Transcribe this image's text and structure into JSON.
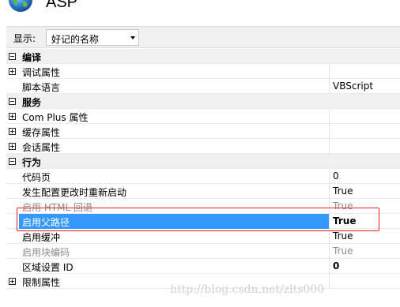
{
  "header": {
    "title": "ASP",
    "icon": "globe-icon"
  },
  "toolbar": {
    "display_label": "显示:",
    "sort_value": "好记的名称"
  },
  "grid": {
    "rows": [
      {
        "type": "category",
        "label": "编译",
        "expander": "minus"
      },
      {
        "type": "group",
        "label": "调试属性",
        "value": "",
        "expander": "plus"
      },
      {
        "type": "prop",
        "label": "脚本语言",
        "value": "VBScript"
      },
      {
        "type": "category",
        "label": "服务",
        "expander": "minus"
      },
      {
        "type": "group",
        "label": "Com Plus 属性",
        "value": "",
        "expander": "plus"
      },
      {
        "type": "group",
        "label": "缓存属性",
        "value": "",
        "expander": "plus"
      },
      {
        "type": "group",
        "label": "会话属性",
        "value": "",
        "expander": "plus"
      },
      {
        "type": "category",
        "label": "行为",
        "expander": "minus"
      },
      {
        "type": "prop",
        "label": "代码页",
        "value": "0"
      },
      {
        "type": "prop",
        "label": "发生配置更改时重新启动",
        "value": "True"
      },
      {
        "type": "prop",
        "label": "启用 HTML 回退",
        "value": "True",
        "dim": true
      },
      {
        "type": "prop",
        "label": "启用父路径",
        "value": "True",
        "selected": true
      },
      {
        "type": "prop",
        "label": "启用缓冲",
        "value": "True"
      },
      {
        "type": "prop",
        "label": "启用块编码",
        "value": "True",
        "dim": true
      },
      {
        "type": "prop",
        "label": "区域设置 ID",
        "value": "0",
        "bold_value": true
      },
      {
        "type": "group",
        "label": "限制属性",
        "value": "",
        "expander": "plus"
      }
    ]
  },
  "watermark": "http://blog.csdn.net/zlts000"
}
